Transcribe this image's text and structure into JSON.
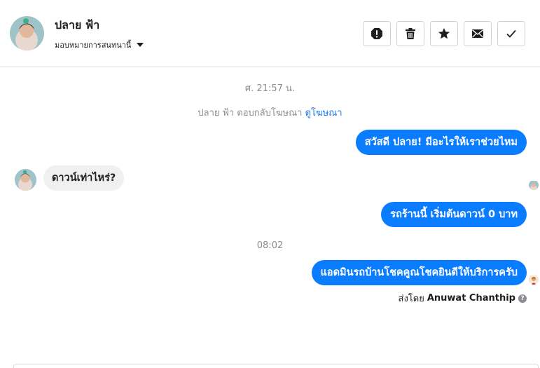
{
  "contact": {
    "name": "ปลาย ฟ้า",
    "assign_label": "มอบหมายการสนทนานี้"
  },
  "toolbar": {
    "buttons": [
      {
        "icon": "alert-icon",
        "name": "mark-spam-button"
      },
      {
        "icon": "trash-icon",
        "name": "delete-button"
      },
      {
        "icon": "star-icon",
        "name": "follow-up-button"
      },
      {
        "icon": "envelope-icon",
        "name": "mark-unread-button"
      },
      {
        "icon": "check-icon",
        "name": "mark-done-button"
      }
    ]
  },
  "thread": {
    "timestamp_1": "ศ. 21:57 น.",
    "ad_reply": {
      "prefix": "ปลาย ฟ้า ตอบกลับโฆษณา",
      "link": "ดูโฆษณา"
    },
    "messages": [
      {
        "direction": "out",
        "text": "สวัสดี ปลาย! มีอะไรให้เราช่วยไหม"
      },
      {
        "direction": "in",
        "text": "ดาวน์เท่าไหร่?"
      },
      {
        "direction": "out",
        "text": "รถร้านนี้ เริ่มต้นดาวน์ 0 บาท"
      },
      {
        "direction": "out",
        "text": "แอดมินรถบ้านโชคคูณโชคยินดีให้บริการครับ"
      }
    ],
    "timestamp_2": "08:02",
    "sent_by_label": "ส่งโดย",
    "sent_by_agent": "Anuwat Chanthip"
  },
  "colors": {
    "accent": "#0a7cff",
    "incoming_bg": "#f0f0f0",
    "muted": "#8a8d91",
    "link": "#1877f2"
  }
}
